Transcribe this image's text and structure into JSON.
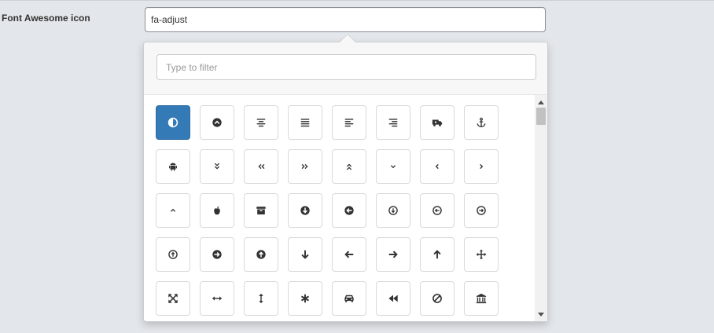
{
  "form": {
    "label": "Font Awesome icon",
    "value": "fa-adjust"
  },
  "picker": {
    "filter_placeholder": "Type to filter",
    "accent_color": "#337ab7",
    "icons": [
      "adjust-icon",
      "chevron-circle-up-icon",
      "align-center-icon",
      "align-justify-icon",
      "align-left-icon",
      "align-right-icon",
      "ambulance-icon",
      "anchor-icon",
      "android-icon",
      "angle-double-down-icon",
      "angle-double-left-icon",
      "angle-double-right-icon",
      "angle-double-up-icon",
      "angle-down-icon",
      "angle-left-icon",
      "angle-right-icon",
      "angle-up-icon",
      "apple-icon",
      "archive-icon",
      "arrow-circle-down-icon",
      "arrow-circle-left-icon",
      "arrow-circle-o-down-icon",
      "arrow-circle-o-left-icon",
      "arrow-circle-o-right-icon",
      "arrow-circle-o-up-icon",
      "arrow-circle-right-icon",
      "arrow-circle-up-icon",
      "arrow-down-icon",
      "arrow-left-icon",
      "arrow-right-icon",
      "arrow-up-icon",
      "arrows-icon",
      "arrows-alt-icon",
      "arrows-h-icon",
      "arrows-v-icon",
      "asterisk-icon",
      "automobile-icon",
      "backward-icon",
      "ban-icon",
      "bank-icon"
    ]
  }
}
